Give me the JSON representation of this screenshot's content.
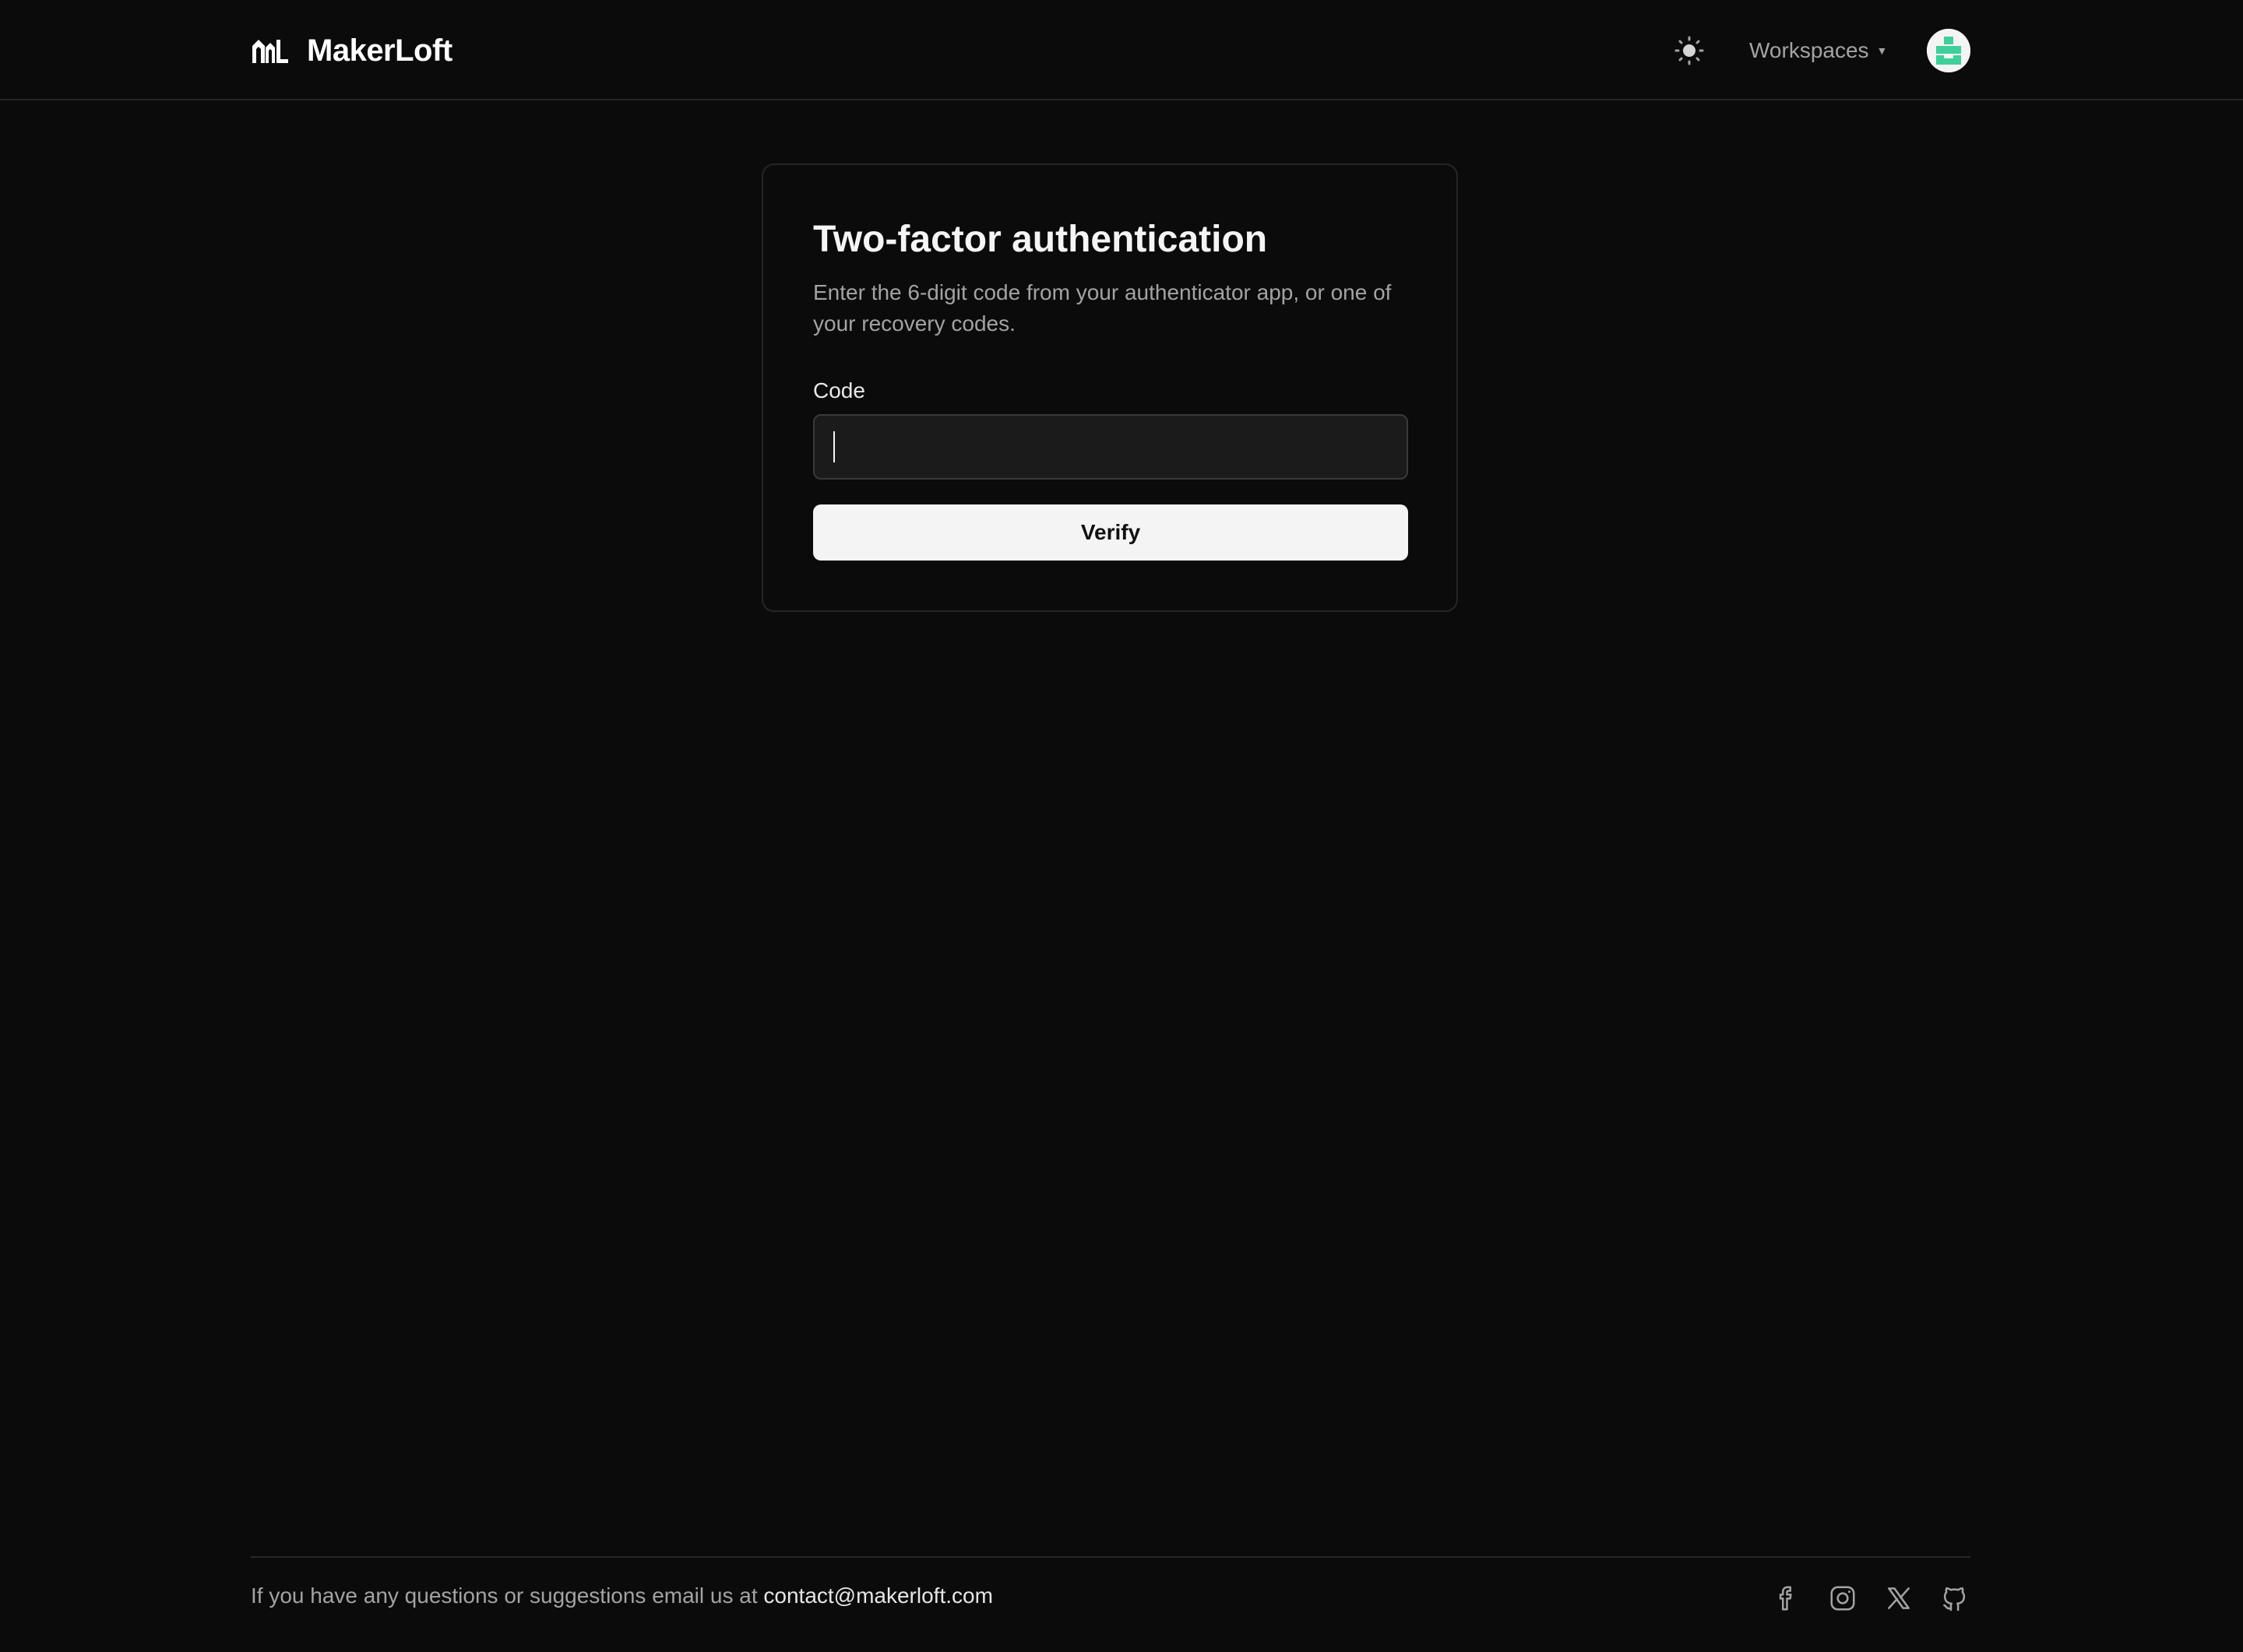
{
  "header": {
    "brand": "MakerLoft",
    "theme_toggle_icon": "sun-icon",
    "workspaces_label": "Workspaces",
    "avatar_colors": [
      "#3ecf9a",
      "#f4f4f4"
    ]
  },
  "card": {
    "title": "Two-factor authentication",
    "description": "Enter the 6-digit code from your authenticator app, or one of your recovery codes.",
    "code_label": "Code",
    "code_value": "",
    "verify_label": "Verify"
  },
  "footer": {
    "text": "If you have any questions or suggestions email us at",
    "email": "contact@makerloft.com",
    "social_icons": [
      "facebook-icon",
      "instagram-icon",
      "x-icon",
      "github-icon"
    ]
  },
  "colors": {
    "background": "#0b0b0b",
    "border": "#262626",
    "muted_text": "#a3a3a3",
    "button_bg": "#f4f4f4"
  }
}
